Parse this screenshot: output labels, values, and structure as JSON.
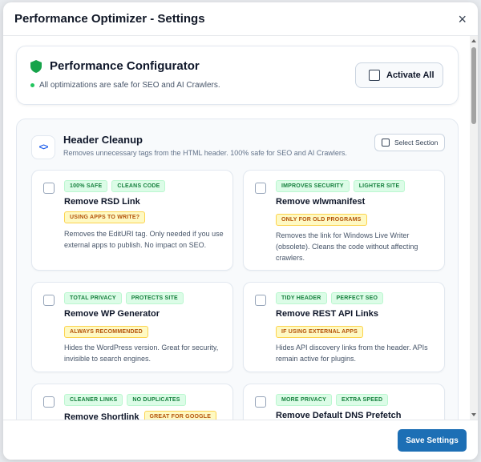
{
  "window": {
    "title": "Performance Optimizer - Settings",
    "close_label": "×"
  },
  "config": {
    "title": "Performance Configurator",
    "subtitle": "All optimizations are safe for SEO and AI Crawlers.",
    "activate_label": "Activate All"
  },
  "section": {
    "icon_label": "<>",
    "title": "Header Cleanup",
    "description": "Removes unnecessary tags from the HTML header. 100% safe for SEO and AI Crawlers.",
    "select_label": "Select Section"
  },
  "options": [
    {
      "badges": [
        "100% SAFE",
        "CLEANS CODE"
      ],
      "title": "Remove RSD Link",
      "warn": "USING APPS TO WRITE?",
      "desc": "Removes the EditURI tag. Only needed if you use external apps to publish. No impact on SEO."
    },
    {
      "badges": [
        "IMPROVES SECURITY",
        "LIGHTER SITE"
      ],
      "title": "Remove wlwmanifest",
      "warn": "ONLY FOR OLD PROGRAMS",
      "desc": "Removes the link for Windows Live Writer (obsolete). Cleans the code without affecting crawlers."
    },
    {
      "badges": [
        "TOTAL PRIVACY",
        "PROTECTS SITE"
      ],
      "title": "Remove WP Generator",
      "warn": "ALWAYS RECOMMENDED",
      "desc": "Hides the WordPress version. Great for security, invisible to search engines."
    },
    {
      "badges": [
        "TIDY HEADER",
        "PERFECT SEO"
      ],
      "title": "Remove REST API Links",
      "warn": "IF USING EXTERNAL APPS",
      "desc": "Hides API discovery links from the header. APIs remain active for plugins."
    },
    {
      "badges": [
        "CLEANER LINKS",
        "NO DUPLICATES"
      ],
      "title": "Remove Shortlink",
      "warn": "GREAT FOR GOOGLE",
      "desc": ""
    },
    {
      "badges": [
        "MORE PRIVACY",
        "EXTRA SPEED"
      ],
      "title": "Remove Default DNS Prefetch",
      "warn": "",
      "desc": ""
    }
  ],
  "footer": {
    "save_label": "Save Settings"
  },
  "colors": {
    "primary": "#1d6fb5",
    "green": "#22c55e",
    "accent_blue": "#2563eb"
  }
}
